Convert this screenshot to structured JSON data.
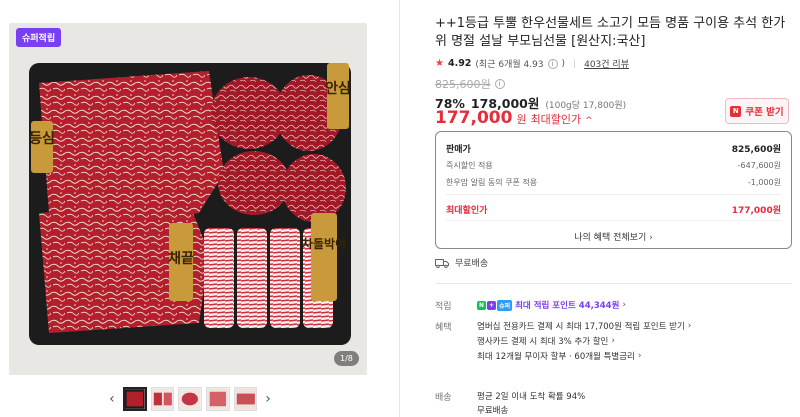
{
  "gallery": {
    "badge": "슈퍼적립",
    "counter": "1/8",
    "prev_arrow": "‹",
    "next_arrow": "›",
    "plaques": [
      "등심",
      "안심",
      "채끝",
      "차돌박이"
    ],
    "thumbnail_count": 5
  },
  "product": {
    "title": "++1등급 투뿔 한우선물세트 소고기 모듬 명품 구이용 추석 한가위 명절 설날 부모님선물 [원산지:국산]",
    "rating": "4.92",
    "rating_recent": "(최근 6개월 4.93",
    "rating_recent_close": ")",
    "review_count": "403건 리뷰",
    "original_price": "825,600원",
    "sale_rate": "78%",
    "sale_price": "178,000원",
    "unit_price": "(100g당 17,800원)",
    "max_discount_price": "177,000",
    "max_discount_unit": "원",
    "max_discount_label": "최대할인가",
    "coupon_button": "쿠폰 받기",
    "coupon_icon_letter": "N"
  },
  "breakdown": {
    "rows": [
      {
        "label": "판매가",
        "value": "825,600원"
      },
      {
        "label": "즉시할인 적용",
        "value": "-647,600원"
      },
      {
        "label": "한우맘 알림 동의 쿠폰 적용",
        "value": "-1,000원"
      }
    ],
    "max": {
      "label": "최대할인가",
      "value": "177,000원"
    },
    "view_all": "나의 혜택 전체보기"
  },
  "shipping": {
    "free": "무료배송",
    "label": "배송",
    "arrival": "평균 2일 이내 도착 확률 94%",
    "free2": "무료배송"
  },
  "points": {
    "label": "적립",
    "chip_n": "N",
    "chip_plus": "+",
    "chip_super": "슈퍼",
    "text": "최대 적립 포인트",
    "amount": "44,344원"
  },
  "benefits": {
    "label": "혜택",
    "lines": [
      "염버십 전용카드 결제 시 최대 17,700원 적립 포인트 받기",
      "행사카드 결제 시 최대 3% 추가 할인",
      "최대 12개월 무이자 할부 · 60개월 특별금리"
    ]
  },
  "colors": {
    "accent_red": "#e52d3b",
    "accent_purple": "#7a3ff2",
    "naver_green": "#03c75a",
    "beef_red": "#b01e2a",
    "tray_dark": "#1c1c1c"
  }
}
